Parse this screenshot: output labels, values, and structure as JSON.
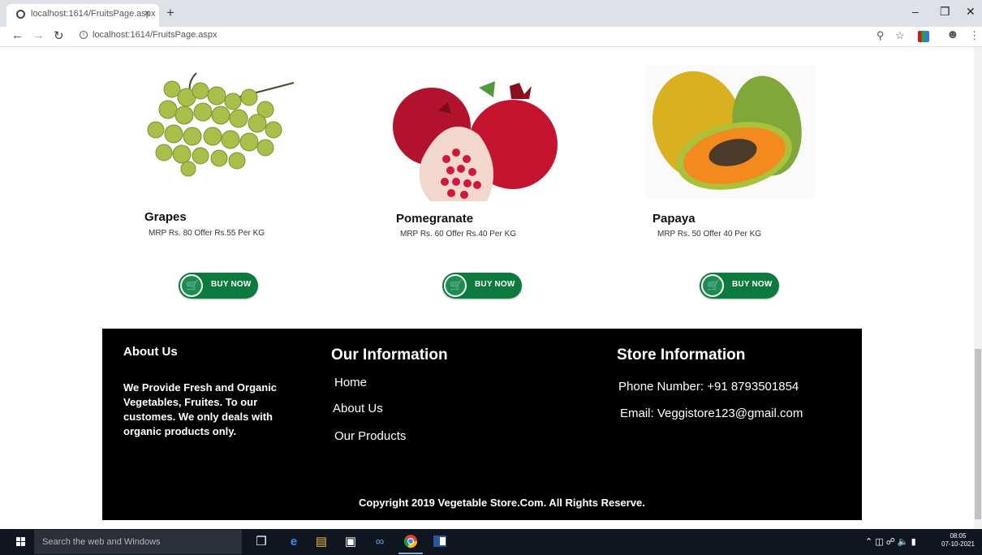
{
  "browser": {
    "tab_title": "localhost:1614/FruitsPage.aspx",
    "tab_close": "×",
    "new_tab": "+",
    "url": "localhost:1614/FruitsPage.aspx"
  },
  "products": [
    {
      "name": "Grapes",
      "price": "MRP Rs. 80 Offer Rs.55 Per KG",
      "button": "BUY NOW"
    },
    {
      "name": "Pomegranate",
      "price": "MRP Rs. 60 Offer Rs.40 Per KG",
      "button": "BUY NOW"
    },
    {
      "name": "Papaya",
      "price": "MRP Rs. 50 Offer 40 Per KG",
      "button": "BUY NOW"
    }
  ],
  "footer": {
    "about_heading": "About Us",
    "about_text": "We Provide Fresh and Organic Vegetables, Fruites. To our customes. We only deals with organic products only.",
    "info_heading": "Our Information",
    "links": [
      "Home",
      "About Us",
      "Our Products"
    ],
    "store_heading": "Store Information",
    "phone": "Phone Number: +91 8793501854",
    "email": "Email: Veggistore123@gmail.com",
    "copyright": "Copyright 2019 Vegetable Store.Com. All Rights Reserve."
  },
  "taskbar": {
    "search_placeholder": "Search the web and Windows",
    "time": "08:05",
    "date": "07-10-2021"
  }
}
